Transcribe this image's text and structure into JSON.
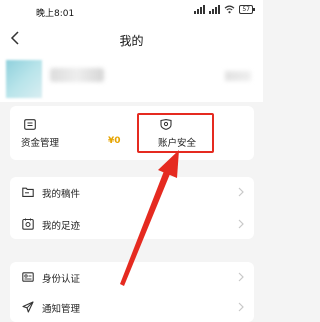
{
  "status_bar": {
    "time": "晚上8:01",
    "battery": "57"
  },
  "header": {
    "title": "我的"
  },
  "fund_card": {
    "fund_management_label": "资金管理",
    "fund_amount": "¥0",
    "account_security_label": "账户安全"
  },
  "list_a": {
    "items": [
      {
        "label": "我的稿件",
        "icon": "folder-icon"
      },
      {
        "label": "我的足迹",
        "icon": "footprint-icon"
      }
    ]
  },
  "list_b": {
    "items": [
      {
        "label": "身份认证",
        "icon": "id-card-icon"
      },
      {
        "label": "通知管理",
        "icon": "send-icon"
      }
    ]
  },
  "colors": {
    "accent_red": "#e52a20",
    "amount_gold": "#e6a400"
  }
}
